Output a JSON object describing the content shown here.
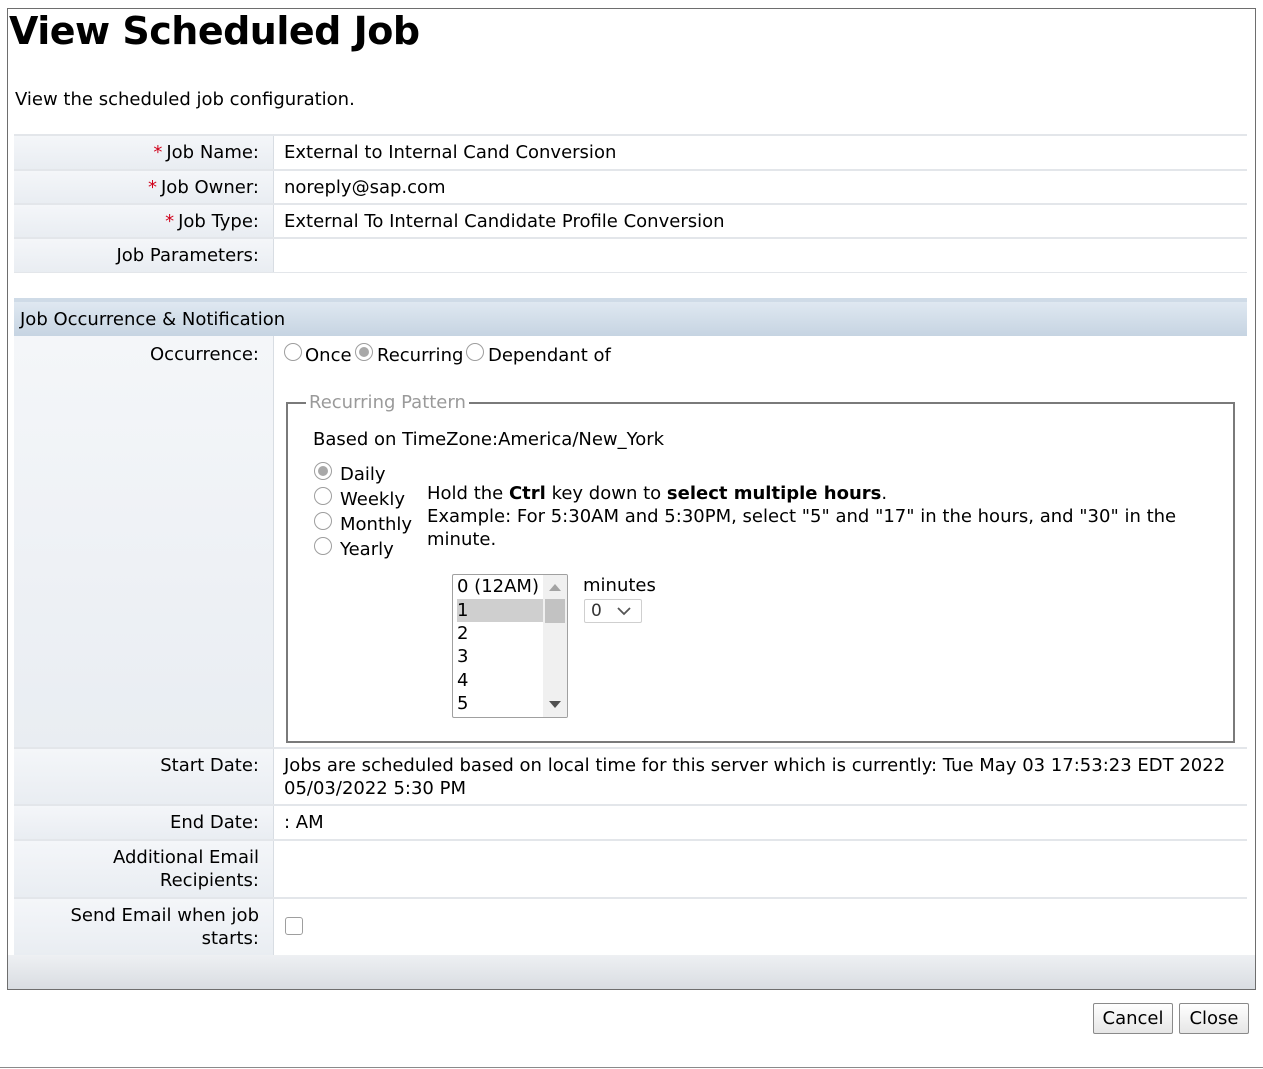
{
  "title": "View Scheduled Job",
  "description": "View the scheduled job configuration.",
  "fields": {
    "job_name": {
      "required_mark": "*",
      "label": "Job Name:",
      "value": "External to Internal Cand Conversion"
    },
    "job_owner": {
      "required_mark": "*",
      "label": "Job Owner:",
      "value": "noreply@sap.com"
    },
    "job_type": {
      "required_mark": "*",
      "label": "Job Type:",
      "value": "External To Internal Candidate Profile Conversion"
    },
    "job_parameters": {
      "label": "Job Parameters:",
      "value": ""
    }
  },
  "section": {
    "title": "Job Occurrence & Notification"
  },
  "occurrence": {
    "label": "Occurrence:",
    "options": [
      "Once",
      "Recurring",
      "Dependant of"
    ],
    "selected": "Recurring"
  },
  "recurring_pattern": {
    "legend": "Recurring Pattern",
    "timezone_label": "Based on TimeZone:",
    "timezone_value": "America/New_York",
    "frequencies": [
      "Daily",
      "Weekly",
      "Monthly",
      "Yearly"
    ],
    "selected_frequency": "Daily",
    "hint": {
      "part1": "Hold the ",
      "ctrl": "Ctrl",
      "part2": " key down to ",
      "bold": "select multiple hours",
      "part3": ".",
      "example": "Example: For 5:30AM and 5:30PM, select \"5\" and \"17\" in the hours, and \"30\" in the",
      "example_end": "minute."
    },
    "hours": [
      "0 (12AM)",
      "1",
      "2",
      "3",
      "4",
      "5"
    ],
    "selected_hour": "1",
    "minutes_label": "minutes",
    "minutes_value": "0"
  },
  "start_date": {
    "label": "Start Date:",
    "line1": "Jobs are scheduled based on local time for this server which is currently: Tue May 03 17:53:23 EDT 2022",
    "line2": "05/03/2022 5:30 PM"
  },
  "end_date": {
    "label": "End Date:",
    "value": ": AM"
  },
  "additional_email": {
    "label_line1": "Additional Email",
    "label_line2": "Recipients:",
    "value": ""
  },
  "send_email": {
    "label_line1": "Send Email when job",
    "label_line2": "starts:",
    "checked": false
  },
  "buttons": {
    "cancel": "Cancel",
    "close": "Close"
  },
  "icons": {
    "dropdown": "chevron-down-icon",
    "scroll_up": "arrow-up-icon",
    "scroll_down": "arrow-down-icon"
  }
}
